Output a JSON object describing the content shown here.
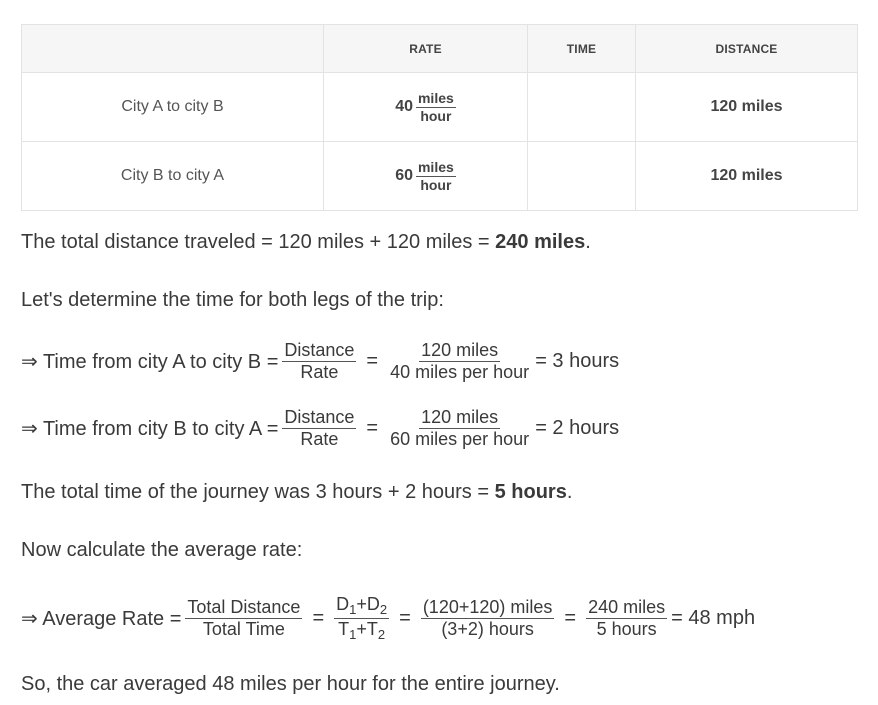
{
  "table": {
    "headers": [
      "",
      "RATE",
      "TIME",
      "DISTANCE"
    ],
    "rows": [
      {
        "leg": "City A to city B",
        "rate": "40",
        "rate_num": "miles",
        "rate_den": "hour",
        "time": "",
        "distance": "120 miles"
      },
      {
        "leg": "City B to city A",
        "rate": "60",
        "rate_num": "miles",
        "rate_den": "hour",
        "time": "",
        "distance": "120 miles"
      }
    ]
  },
  "total_distance": {
    "text": "The total distance traveled = 120 miles + 120 miles = ",
    "bold": "240 miles",
    "end": "."
  },
  "intro_time": "Let's determine the time for both legs of the trip:",
  "time_a": {
    "label": "⇒ Time from city A to city B =",
    "f1_num": "Distance",
    "f1_den": "Rate",
    "eq1": "=",
    "f2_num": "120 miles",
    "f2_den": "40 miles per hour",
    "result": "= 3 hours"
  },
  "time_b": {
    "label": "⇒ Time from city B to city A =",
    "f1_num": "Distance",
    "f1_den": "Rate",
    "eq1": "=",
    "f2_num": "120 miles",
    "f2_den": "60 miles per hour",
    "result": "= 2 hours"
  },
  "total_time": {
    "text": "The total time of the journey was 3 hours + 2 hours = ",
    "bold": "5 hours",
    "end": "."
  },
  "avg_intro": "Now calculate the average rate:",
  "avg": {
    "label": "⇒ Average Rate =",
    "f1_num": "Total Distance",
    "f1_den": "Total Time",
    "eq": "=",
    "d1": "D",
    "s1": "1",
    "plus": "+",
    "d2": "D",
    "s2": "2",
    "t1": "T",
    "ts1": "1",
    "t2": "T",
    "ts2": "2",
    "f3_num": "(120+120) miles",
    "f3_den": "(3+2) hours",
    "f4_num": "240 miles",
    "f4_den": "5 hours",
    "result": "= 48 mph"
  },
  "conclusion": "So, the car averaged 48 miles per hour for the entire journey."
}
